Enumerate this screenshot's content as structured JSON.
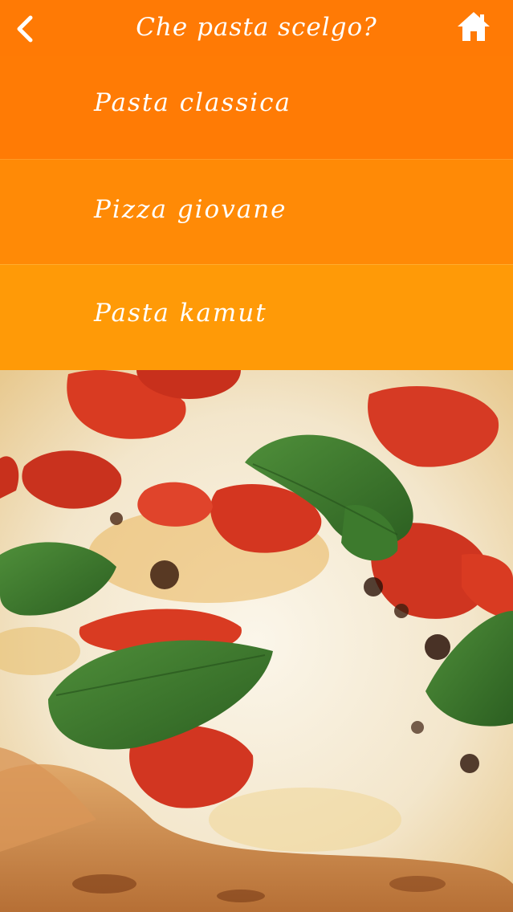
{
  "header": {
    "title": "Che pasta scelgo?",
    "back_icon": "chevron-left-icon",
    "home_icon": "home-icon"
  },
  "menu": {
    "items": [
      {
        "label": "Pasta classica"
      },
      {
        "label": "Pizza giovane"
      },
      {
        "label": "Pasta kamut"
      }
    ]
  },
  "image": {
    "subject": "pizza-margherita-photo"
  },
  "colors": {
    "accent": "#ff7a05",
    "row_1": "#ff7b05",
    "row_2": "#ff8a06",
    "row_3": "#ff9a07",
    "text": "#ffffff"
  }
}
